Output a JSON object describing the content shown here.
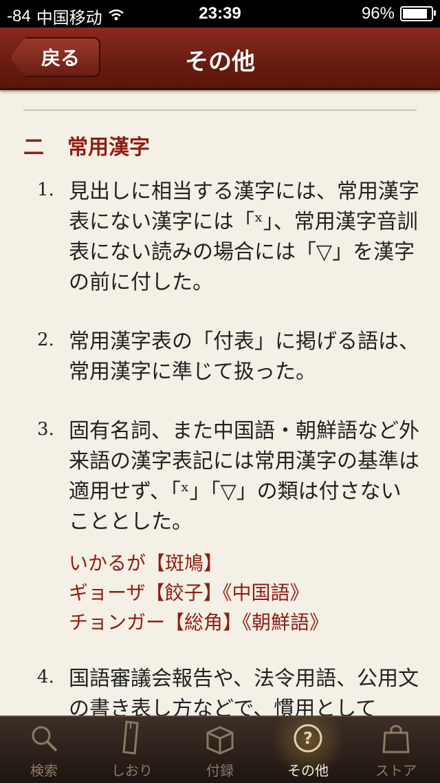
{
  "status": {
    "signal": "-84",
    "carrier": "中国移动",
    "time": "23:39",
    "battery_percent": "96%",
    "battery_level": 0.96
  },
  "nav": {
    "back_label": "戻る",
    "title": "その他"
  },
  "section": {
    "marker": "二",
    "title": "常用漢字"
  },
  "items": [
    {
      "num": "1.",
      "text": "見出しに相当する漢字には、常用漢字表にない漢字には「ˣ」、常用漢字音訓表にない読みの場合には「▽」を漢字の前に付した。"
    },
    {
      "num": "2.",
      "text": "常用漢字表の「付表」に掲げる語は、常用漢字に準じて扱った。"
    },
    {
      "num": "3.",
      "text": "固有名詞、また中国語・朝鮮語など外来語の漢字表記には常用漢字の基準は適用せず、「ˣ」「▽」の類は付さないこととした。"
    },
    {
      "num": "4.",
      "text": "国語審議会報告や、法令用語、公用文の書き表し方などで、慣用として"
    }
  ],
  "examples": [
    "いかるが【斑鳩】",
    "ギョーザ【餃子】《中国語》",
    "チョンガー【総角】《朝鮮語》"
  ],
  "tabs": [
    {
      "label": "検索",
      "icon": "search-icon"
    },
    {
      "label": "しおり",
      "icon": "bookmark-icon"
    },
    {
      "label": "付録",
      "icon": "box-icon"
    },
    {
      "label": "その他",
      "icon": "question-icon",
      "active": true
    },
    {
      "label": "ストア",
      "icon": "shopping-bag-icon"
    }
  ],
  "colors": {
    "accent_red": "#8f1d13",
    "nav_bar": "#6b1d12",
    "tab_active": "#f2ead8"
  }
}
